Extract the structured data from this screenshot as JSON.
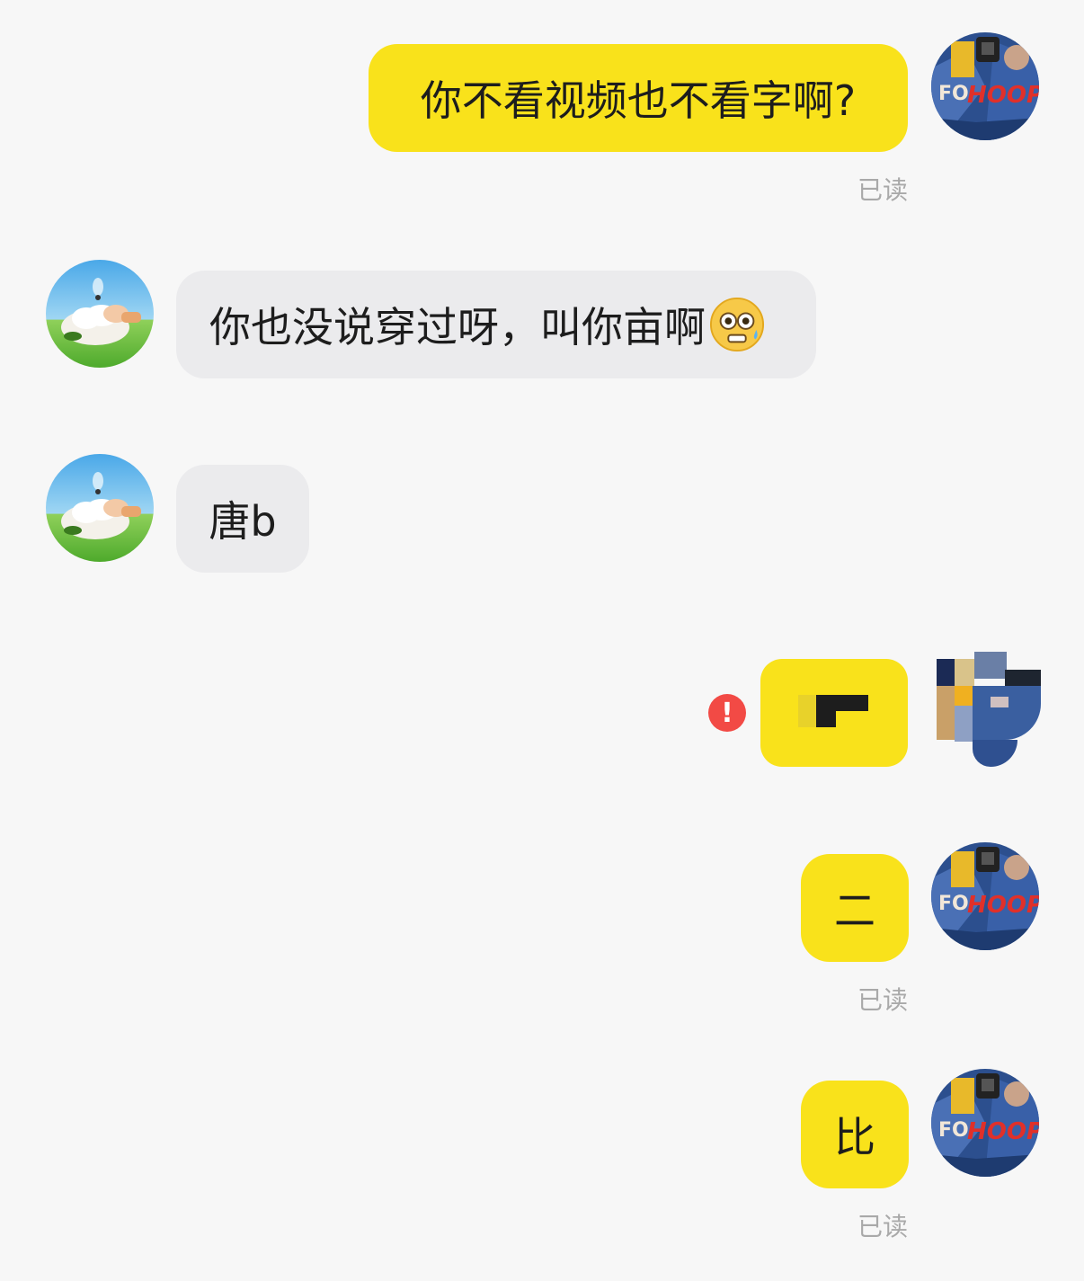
{
  "messages": [
    {
      "sender": "me",
      "text": "你不看视频也不看字啊?",
      "status": "已读"
    },
    {
      "sender": "other",
      "text": "你也没说穿过呀，叫你亩啊",
      "emoji": "flushed-sweat-emoji"
    },
    {
      "sender": "other",
      "text": "唐b"
    },
    {
      "sender": "me",
      "text": "",
      "failed": true,
      "fail_icon": "!",
      "pixelated": true
    },
    {
      "sender": "me",
      "text": "二",
      "status": "已读"
    },
    {
      "sender": "me",
      "text": "比",
      "status": "已读"
    }
  ],
  "avatars": {
    "me": {
      "icon": "jersey-avatar",
      "jersey_text": "HOOP"
    },
    "other": {
      "icon": "sheep-avatar"
    }
  },
  "colors": {
    "background": "#f7f7f7",
    "my_bubble": "#f9e21b",
    "their_bubble": "#ebebed",
    "read_text": "#a9a9a9",
    "fail_red": "#f24a45"
  }
}
